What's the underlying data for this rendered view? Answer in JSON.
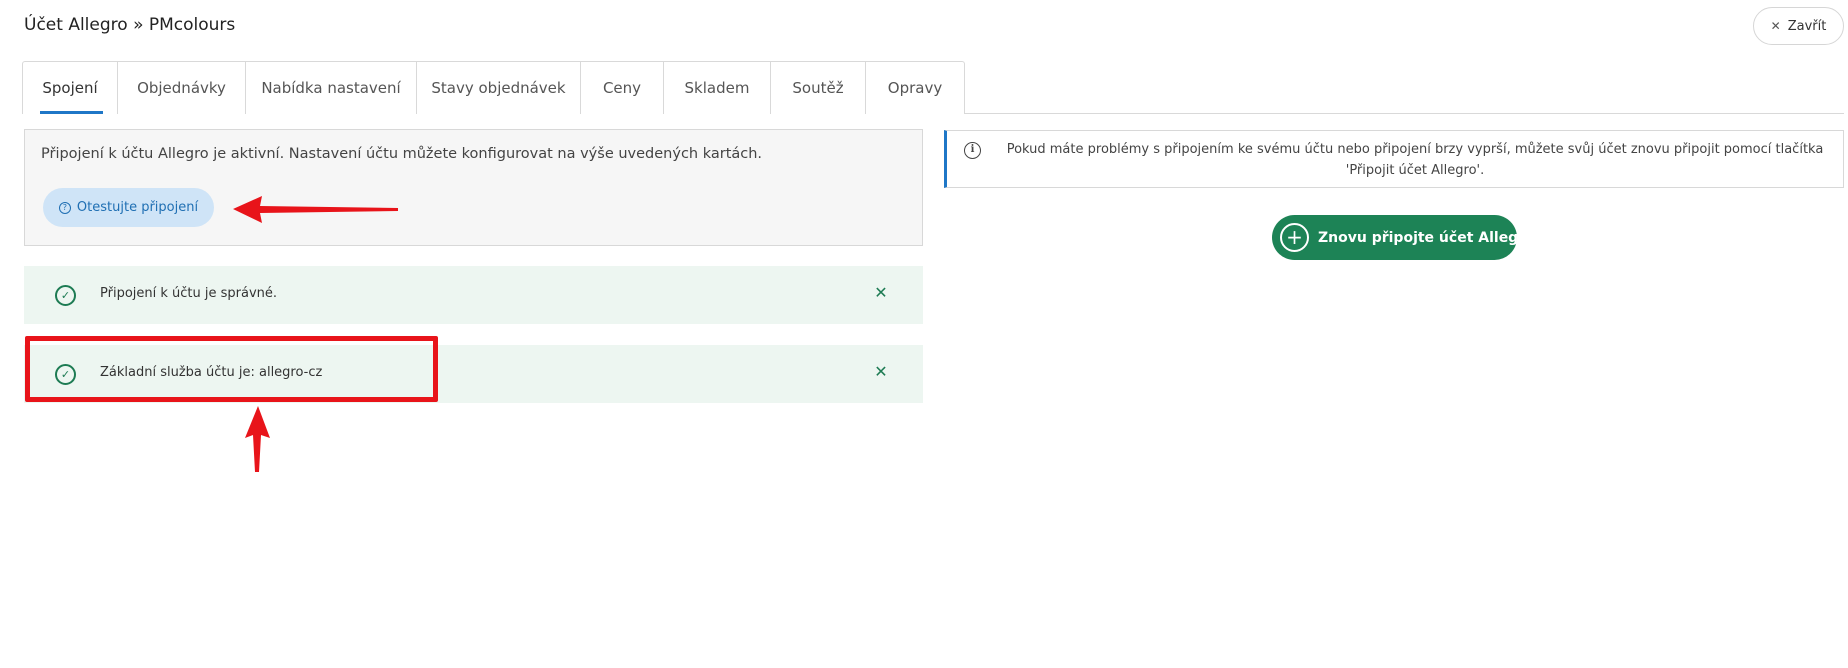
{
  "header": {
    "title": "Účet Allegro » PMcolours",
    "close_label": "Zavřít"
  },
  "tabs": [
    {
      "label": "Spojení",
      "active": true
    },
    {
      "label": "Objednávky",
      "active": false
    },
    {
      "label": "Nabídka nastavení",
      "active": false
    },
    {
      "label": "Stavy objednávek",
      "active": false
    },
    {
      "label": "Ceny",
      "active": false
    },
    {
      "label": "Skladem",
      "active": false
    },
    {
      "label": "Soutěž",
      "active": false
    },
    {
      "label": "Opravy",
      "active": false
    }
  ],
  "connection": {
    "status_text": "Připojení k účtu Allegro je aktivní. Nastavení účtu můžete konfigurovat na výše uvedených kartách.",
    "test_button_label": "Otestujte připojení"
  },
  "alerts": [
    {
      "text": "Připojení k účtu je správné."
    },
    {
      "text": "Základní služba účtu je: allegro-cz"
    }
  ],
  "info": {
    "text": "Pokud máte problémy s připojením ke svému účtu nebo připojení brzy vyprší, můžete svůj účet znovu připojit pomocí tlačítka 'Připojit účet Allegro'."
  },
  "reconnect_button_label": "Znovu připojte účet Allegro",
  "colors": {
    "accent_blue": "#1f77c7",
    "success_green": "#1d8356",
    "annotation_red": "#e8141a"
  }
}
